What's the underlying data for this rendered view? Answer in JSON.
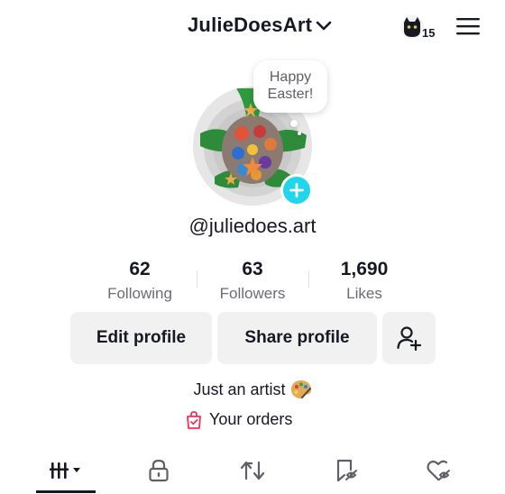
{
  "header": {
    "username": "JulieDoesArt",
    "notification_count": "15"
  },
  "profile": {
    "note": [
      "Happy",
      "Easter!"
    ],
    "handle": "@juliedoes.art",
    "accent_color": "#20d5ec"
  },
  "stats": [
    {
      "value": "62",
      "label": "Following"
    },
    {
      "value": "63",
      "label": "Followers"
    },
    {
      "value": "1,690",
      "label": "Likes"
    }
  ],
  "actions": {
    "edit_profile": "Edit profile",
    "share_profile": "Share profile",
    "add_friend_icon": "add-user-icon"
  },
  "bio": {
    "text": "Just an artist",
    "emoji_icon": "artist-palette-icon"
  },
  "orders": {
    "label": "Your orders",
    "icon": "shopping-bag-icon",
    "icon_color": "#fe2c55"
  },
  "tabs": [
    {
      "icon": "videos-grid-icon",
      "active": true
    },
    {
      "icon": "lock-icon",
      "active": false
    },
    {
      "icon": "repost-icon",
      "active": false
    },
    {
      "icon": "favorites-icon",
      "active": false
    },
    {
      "icon": "liked-icon",
      "active": false
    }
  ]
}
